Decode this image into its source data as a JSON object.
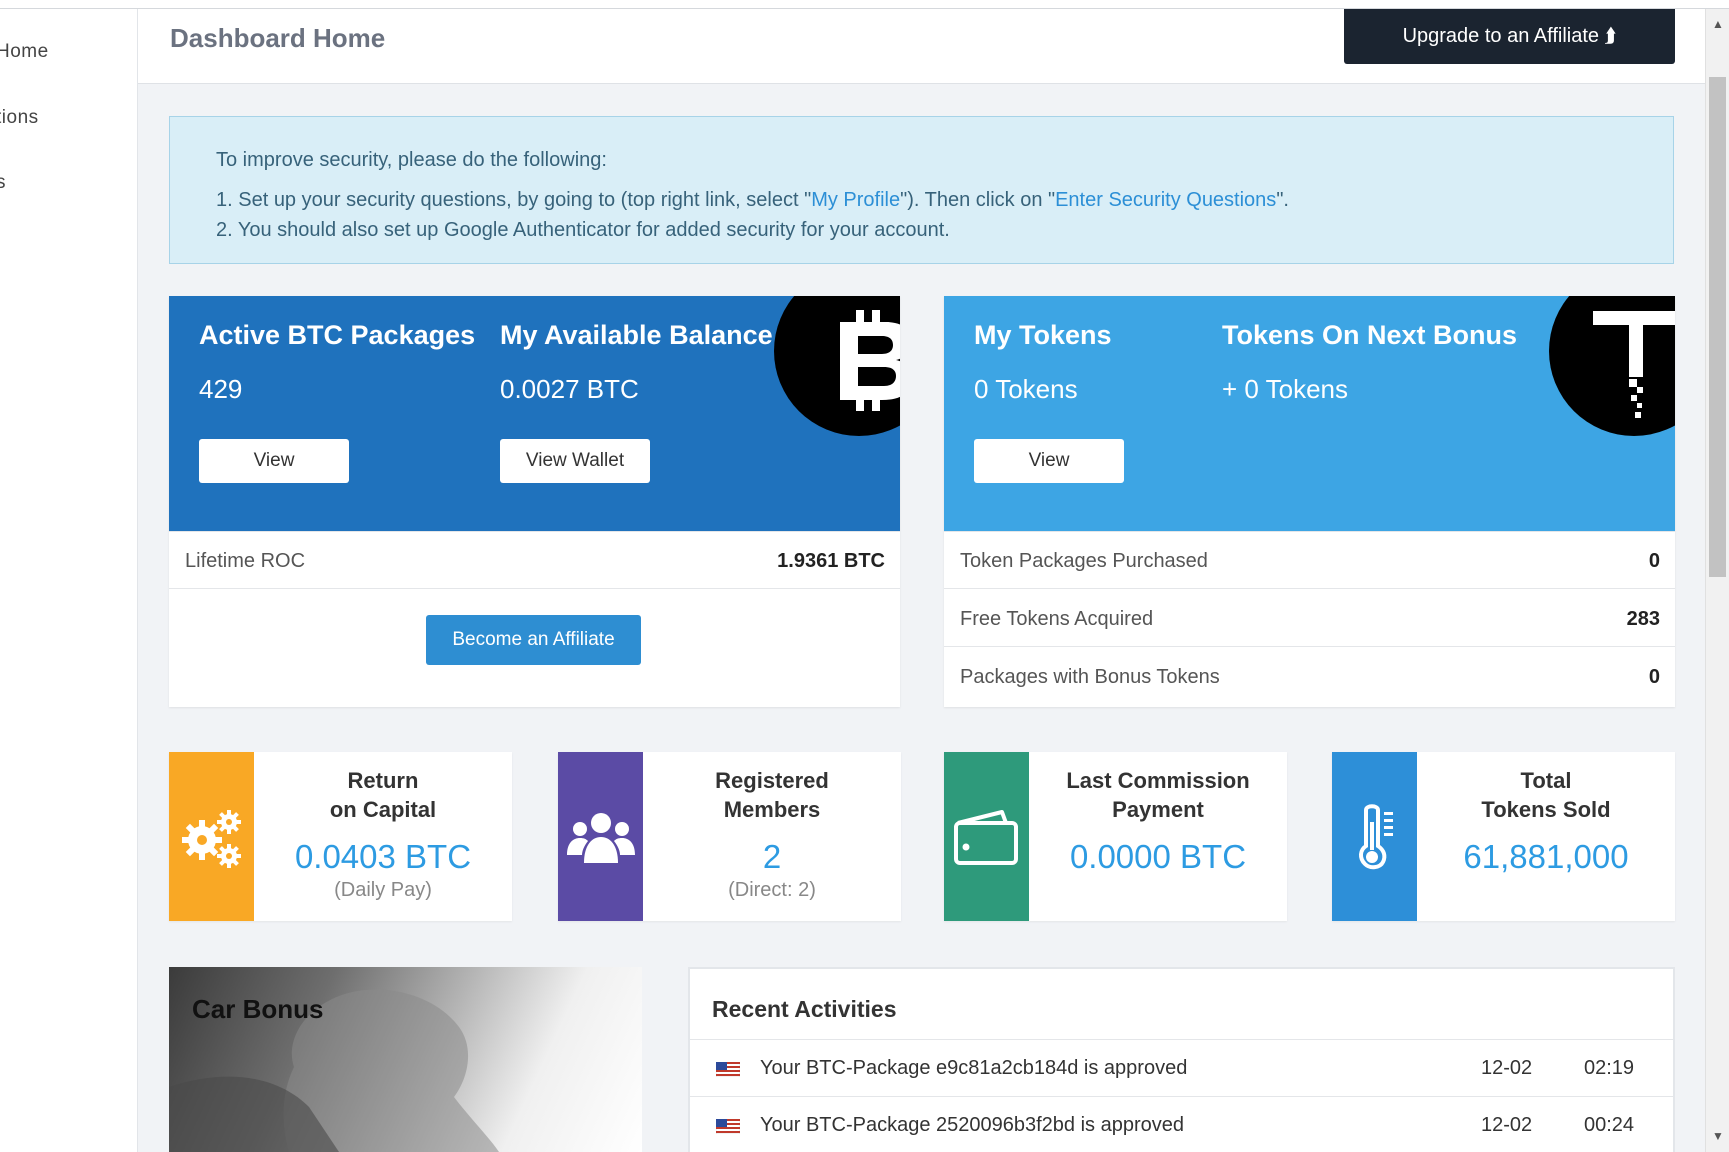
{
  "sidebar": {
    "items": [
      {
        "label": "Home"
      },
      {
        "label": "tions"
      },
      {
        "label": "s"
      }
    ]
  },
  "header": {
    "title": "Dashboard Home",
    "upgrade_label": "Upgrade to an Affiliate ⮭"
  },
  "alert": {
    "intro": "To improve security, please do the following:",
    "step1_prefix": "1. Set up your security questions, by going to (top right link, select \"",
    "step1_link1": "My Profile",
    "step1_mid": "\"). Then click on \"",
    "step1_link2": "Enter Security Questions",
    "step1_suffix": "\".",
    "step2": "2. You should also set up Google Authenticator for added security for your account."
  },
  "btc_panel": {
    "active_title": "Active BTC Packages",
    "active_value": "429",
    "active_button": "View",
    "balance_title": "My Available Balance",
    "balance_value": "0.0027 BTC",
    "balance_button": "View Wallet",
    "coin_symbol": "B",
    "lifetime_label": "Lifetime ROC",
    "lifetime_value": "1.9361 BTC",
    "affiliate_button": "Become an Affiliate",
    "accent": "#1f72bd"
  },
  "token_panel": {
    "tokens_title": "My Tokens",
    "tokens_value": "0 Tokens",
    "tokens_button": "View",
    "next_title": "Tokens On Next Bonus",
    "next_value": "+ 0 Tokens",
    "coin_symbol": "T",
    "rows": [
      {
        "label": "Token Packages Purchased",
        "value": "0"
      },
      {
        "label": "Free Tokens Acquired",
        "value": "283"
      },
      {
        "label": "Packages with Bonus Tokens",
        "value": "0"
      }
    ],
    "accent": "#3da5e4"
  },
  "stats": [
    {
      "label_line1": "Return",
      "label_line2": "on Capital",
      "value": "0.0403 BTC",
      "sub": "(Daily Pay)",
      "icon": "gears-icon",
      "color": "#f9a825"
    },
    {
      "label_line1": "Registered",
      "label_line2": "Members",
      "value": "2",
      "sub": "(Direct: 2)",
      "icon": "users-icon",
      "color": "#5b4ba5"
    },
    {
      "label_line1": "Last Commission",
      "label_line2": "Payment",
      "value": "0.0000 BTC",
      "sub": "",
      "icon": "wallet-icon",
      "color": "#2e9a7b"
    },
    {
      "label_line1": "Total",
      "label_line2": "Tokens Sold",
      "value": "61,881,000",
      "sub": "",
      "icon": "thermometer-icon",
      "color": "#2d8fd8"
    }
  ],
  "car_bonus": {
    "title": "Car Bonus"
  },
  "recent": {
    "title": "Recent Activities",
    "items": [
      {
        "text": "Your BTC-Package e9c81a2cb184d is approved",
        "date": "12-02",
        "time": "02:19"
      },
      {
        "text": "Your BTC-Package 2520096b3f2bd is approved",
        "date": "12-02",
        "time": "00:24"
      }
    ]
  }
}
